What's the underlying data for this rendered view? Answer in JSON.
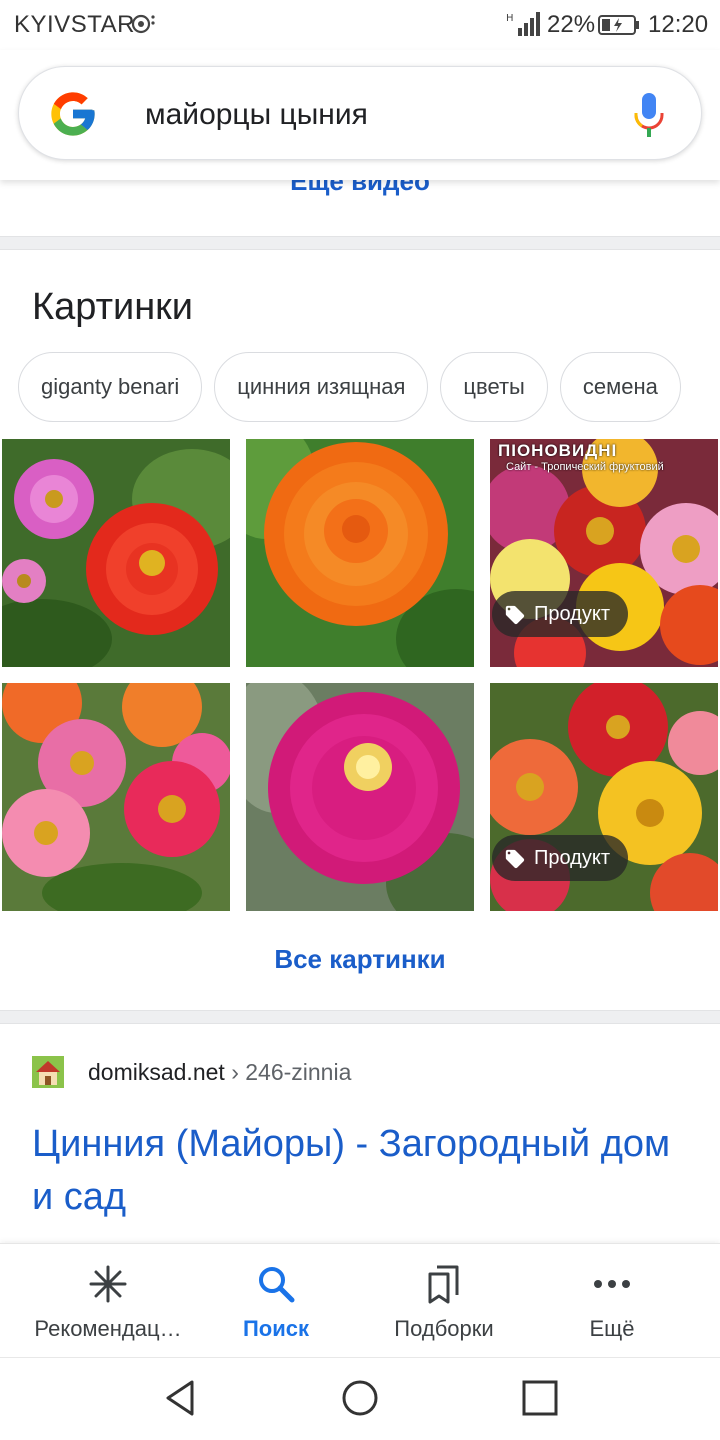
{
  "status_bar": {
    "carrier": "KYIVSTAR",
    "battery_percent": "22%",
    "time": "12:20"
  },
  "search": {
    "query": "майорцы цыния"
  },
  "videos": {
    "more_link": "Еще видео"
  },
  "images_section": {
    "title": "Картинки",
    "chips": [
      "giganty benari",
      "цинния изящная",
      "цветы",
      "семена"
    ],
    "product_badge": "Продукт",
    "overlay_text": "ПІОНОВИДНІ",
    "overlay_sub": "Сайт - Тропический фруктовий",
    "all_link": "Все картинки"
  },
  "result": {
    "site": "domiksad.net",
    "path": " › 246-zinnia",
    "title": "Цинния (Майоры) - Загородный дом и сад"
  },
  "bottom_nav": {
    "items": [
      {
        "label": "Рекомендац…",
        "icon": "asterisk-icon"
      },
      {
        "label": "Поиск",
        "icon": "search-icon"
      },
      {
        "label": "Подборки",
        "icon": "collections-icon"
      },
      {
        "label": "Ещё",
        "icon": "more-dots-icon"
      }
    ]
  },
  "colors": {
    "link_blue": "#1a5dc9",
    "active_blue": "#1a73e8"
  }
}
